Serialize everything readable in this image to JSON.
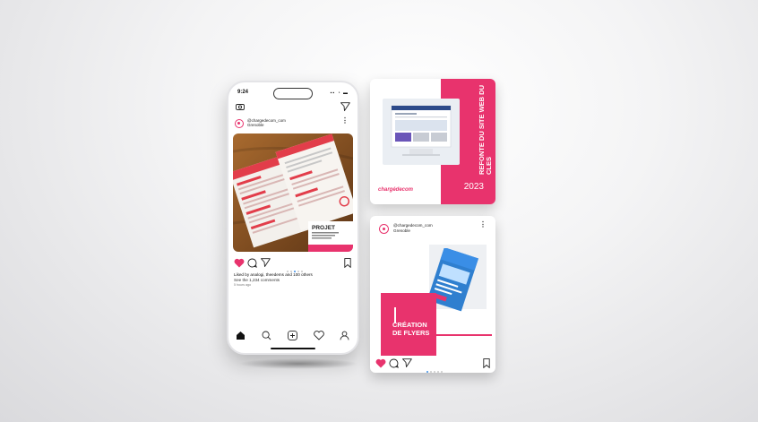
{
  "phone": {
    "status_time": "9:24",
    "status_icons": "▪︎▪︎ ◔ ▬",
    "post": {
      "username": "@chargedecom_com",
      "location": "Grenoble",
      "flyer_title": "PROJET",
      "likes_text": "Liked by analogi, theedems  and  100 others",
      "comments_text": "See the 1,234 comments",
      "time_ago": "5 hours ago"
    },
    "icons": [
      "camera-icon",
      "send-icon",
      "heart-icon",
      "comment-icon",
      "share-icon",
      "bookmark-icon",
      "home-icon",
      "search-icon",
      "add-icon",
      "activity-icon",
      "profile-icon"
    ]
  },
  "card_refonte": {
    "title": "REFONTE DU SITE WEB DU CLES",
    "year": "2023",
    "brand": "chargédecom"
  },
  "card_flyers": {
    "username": "@chargedecom_com",
    "location": "Grenoble",
    "title_line1": "CRÉATION",
    "title_line2": "DE FLYERS"
  },
  "colors": {
    "accent_pink": "#e8336d",
    "heart_red": "#e8336d",
    "flyer_blue": "#3a8ee6"
  }
}
